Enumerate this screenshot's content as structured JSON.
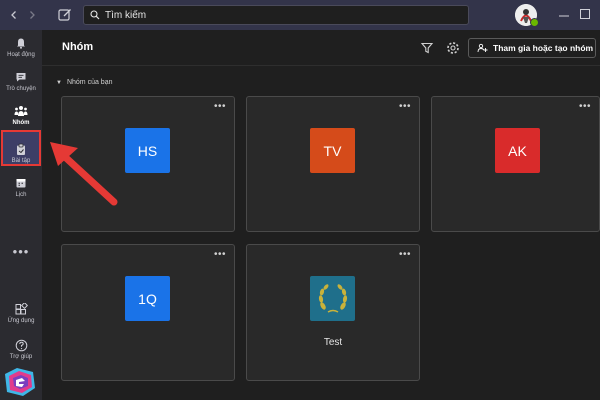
{
  "titlebar": {
    "search_placeholder": "Tìm kiếm"
  },
  "rail": {
    "items": [
      {
        "label": "Hoạt động",
        "icon": "bell-icon"
      },
      {
        "label": "Trò chuyện",
        "icon": "chat-icon"
      },
      {
        "label": "Nhóm",
        "icon": "teams-icon",
        "active": true
      },
      {
        "label": "Bài tập",
        "icon": "assignments-icon"
      },
      {
        "label": "Lịch",
        "icon": "calendar-icon"
      }
    ],
    "more": "•••",
    "apps_label": "Ứng dụng",
    "help_label": "Trợ giúp"
  },
  "header": {
    "title": "Nhóm",
    "join_button": "Tham gia hoặc tạo nhóm"
  },
  "section": {
    "label": "Nhóm của bạn"
  },
  "teams": [
    {
      "initials": "HS",
      "color": "#1a73e8"
    },
    {
      "initials": "TV",
      "color": "#d54b1a"
    },
    {
      "initials": "AK",
      "color": "#d92b2b"
    },
    {
      "initials": "1Q",
      "color": "#1a73e8"
    },
    {
      "initials": "",
      "name": "Test",
      "color": "#1f6f8b"
    }
  ],
  "colors": {
    "accent": "#e53935",
    "rail_active": "#3d3e66",
    "titlebar": "#33344a"
  }
}
